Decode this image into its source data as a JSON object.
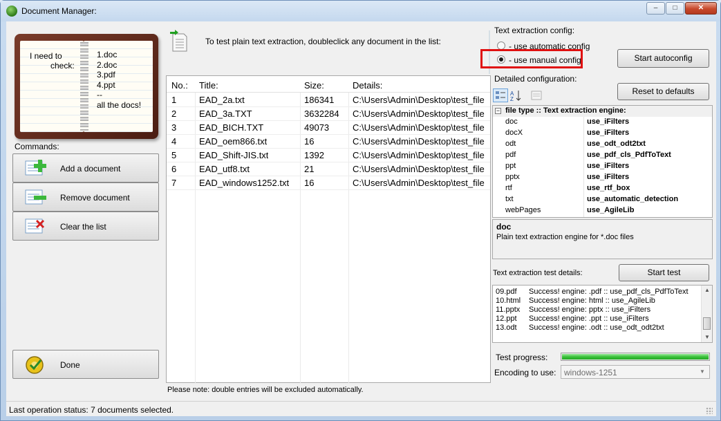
{
  "window": {
    "title": "Document Manager:",
    "controls": {
      "minimize": "–",
      "maximize": "□",
      "close": "✕"
    }
  },
  "illustration": {
    "left_text": [
      "I need to",
      "check:"
    ],
    "right_text": [
      "1.doc",
      "2.doc",
      "3.pdf",
      "4.ppt",
      "--",
      "all the docs!"
    ]
  },
  "hint": {
    "icon": "document-arrow-icon",
    "text": "To test plain text extraction, doubleclick any document in the list:"
  },
  "commands": {
    "label": "Commands:",
    "buttons": [
      {
        "label": "Add a document",
        "icon": "add-document-icon"
      },
      {
        "label": "Remove document",
        "icon": "remove-document-icon"
      },
      {
        "label": "Clear the list",
        "icon": "clear-list-icon"
      }
    ],
    "done": {
      "label": "Done",
      "icon": "done-gear-icon"
    }
  },
  "documents": {
    "headers": [
      "No.:",
      "Title:",
      "Size:",
      "Details:"
    ],
    "rows": [
      {
        "no": "1",
        "title": "EAD_2a.txt",
        "size": "186341",
        "details": "C:\\Users\\Admin\\Desktop\\test_file"
      },
      {
        "no": "2",
        "title": "EAD_3a.TXT",
        "size": "3632284",
        "details": "C:\\Users\\Admin\\Desktop\\test_file"
      },
      {
        "no": "3",
        "title": "EAD_BICH.TXT",
        "size": "49073",
        "details": "C:\\Users\\Admin\\Desktop\\test_file"
      },
      {
        "no": "4",
        "title": "EAD_oem866.txt",
        "size": "16",
        "details": "C:\\Users\\Admin\\Desktop\\test_file"
      },
      {
        "no": "5",
        "title": "EAD_Shift-JIS.txt",
        "size": "1392",
        "details": "C:\\Users\\Admin\\Desktop\\test_file"
      },
      {
        "no": "6",
        "title": "EAD_utf8.txt",
        "size": "21",
        "details": "C:\\Users\\Admin\\Desktop\\test_file"
      },
      {
        "no": "7",
        "title": "EAD_windows1252.txt",
        "size": "16",
        "details": "C:\\Users\\Admin\\Desktop\\test_file"
      }
    ],
    "note": "Please note: double entries will be excluded automatically."
  },
  "config": {
    "group_label": "Text extraction config:",
    "options": [
      {
        "label": "- use automatic config",
        "selected": false
      },
      {
        "label": "- use manual config",
        "selected": true
      }
    ],
    "highlight_color": "#e01010",
    "start_autoconfig": "Start autoconfig",
    "detailed_label": "Detailed configuration:",
    "reset_button": "Reset to defaults",
    "toolbar_icons": [
      "categorized-icon",
      "sort-alpha-icon",
      "property-pages-icon"
    ],
    "grid_header": "file type :: Text extraction engine:",
    "grid_rows": [
      {
        "key": "doc",
        "value": "use_iFilters"
      },
      {
        "key": "docX",
        "value": "use_iFilters"
      },
      {
        "key": "odt",
        "value": "use_odt_odt2txt"
      },
      {
        "key": "pdf",
        "value": "use_pdf_cls_PdfToText"
      },
      {
        "key": "ppt",
        "value": "use_iFilters"
      },
      {
        "key": "pptx",
        "value": "use_iFilters"
      },
      {
        "key": "rtf",
        "value": "use_rtf_box"
      },
      {
        "key": "txt",
        "value": "use_automatic_detection"
      },
      {
        "key": "webPages",
        "value": "use_AgileLib"
      }
    ],
    "description": {
      "title": "doc",
      "text": "Plain text extraction engine for *.doc files"
    }
  },
  "test": {
    "label": "Text extraction test details:",
    "start_button": "Start test",
    "log": [
      {
        "file": "09.pdf",
        "msg": "Success! engine: .pdf :: use_pdf_cls_PdfToText"
      },
      {
        "file": "10.html",
        "msg": "Success! engine: html :: use_AgileLib"
      },
      {
        "file": "11.pptx",
        "msg": "Success! engine: pptx :: use_iFilters"
      },
      {
        "file": "12.ppt",
        "msg": "Success! engine: .ppt :: use_iFilters"
      },
      {
        "file": "13.odt",
        "msg": "Success! engine: .odt :: use_odt_odt2txt"
      }
    ],
    "progress_label": "Test progress:",
    "progress_value": 1.0,
    "encoding_label": "Encoding to use:",
    "encoding_value": "windows-1251"
  },
  "status": {
    "text": "Last operation status:  7 documents selected."
  }
}
